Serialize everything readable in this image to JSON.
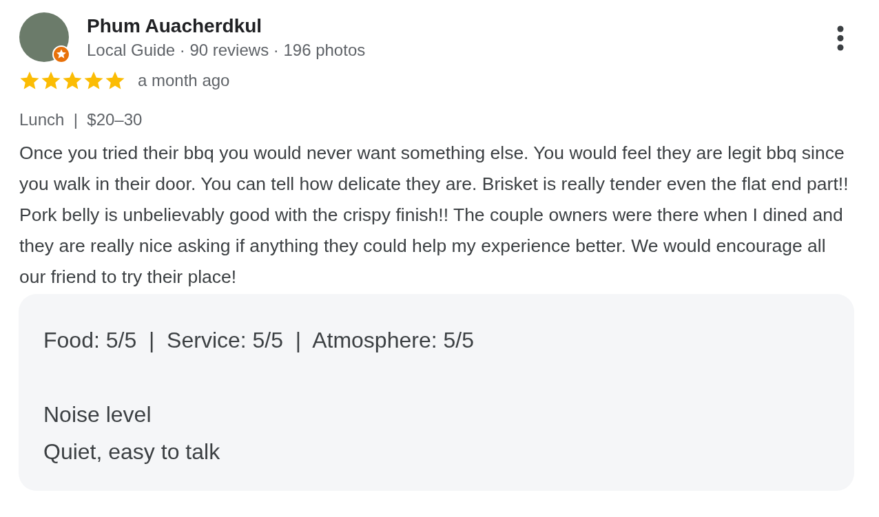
{
  "reviewer": {
    "name": "Phum Auacherdkul",
    "meta": "Local Guide · 90 reviews · 196 photos",
    "local_guide_badge": true
  },
  "review": {
    "stars": 5,
    "time": "a month ago",
    "context": "Lunch  |  $20–30",
    "text": "Once you tried their bbq you would never want something else. You would feel they are legit bbq since you walk in their door. You can tell how delicate they are. Brisket is really tender even the flat end part!! Pork belly is unbelievably good with the crispy finish!! The couple owners were there when I dined and they are really nice asking if anything they could help my experience better. We would encourage all our friend to try their place!"
  },
  "details": {
    "ratings": "Food: 5/5  |  Service: 5/5  |  Atmosphere: 5/5",
    "items": [
      {
        "label": "Noise level",
        "value": "Quiet, easy to talk"
      }
    ]
  }
}
